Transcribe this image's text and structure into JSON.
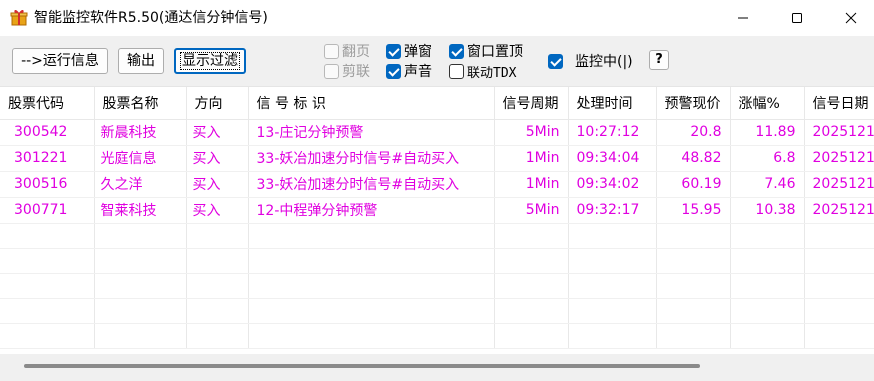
{
  "window": {
    "title": "智能监控软件R5.50(通达信分钟信号)"
  },
  "toolbar": {
    "run_info_label": "-->运行信息",
    "export_label": "输出",
    "filter_label": "显示过滤",
    "checkboxes": {
      "fanye": {
        "label": "翻页",
        "checked": false,
        "disabled": true
      },
      "jianlian": {
        "label": "剪联",
        "checked": false,
        "disabled": true
      },
      "tanchuang": {
        "label": "弹窗",
        "checked": true
      },
      "shengyin": {
        "label": "声音",
        "checked": true
      },
      "zhiding": {
        "label": "窗口置顶",
        "checked": true
      },
      "liandong": {
        "label": "联动TDX",
        "checked": false
      }
    },
    "monitoring_label": "监控中(|)",
    "monitoring_checked": true,
    "help_label": "?"
  },
  "grid": {
    "columns": [
      "股票代码",
      "股票名称",
      "方向",
      "信 号 标 识",
      "信号周期",
      "处理时间",
      "预警现价",
      "涨幅%",
      "信号日期"
    ],
    "rows": [
      [
        "300542",
        "新晨科技",
        "买入",
        "13-庄记分钟预警",
        "5Min",
        "10:27:12",
        "20.8",
        "11.89",
        "2025121"
      ],
      [
        "301221",
        "光庭信息",
        "买入",
        "33-妖冶加速分时信号#自动买入",
        "1Min",
        "09:34:04",
        "48.82",
        "6.8",
        "2025121"
      ],
      [
        "300516",
        "久之洋",
        "买入",
        "33-妖冶加速分时信号#自动买入",
        "1Min",
        "09:34:02",
        "60.19",
        "7.46",
        "2025121"
      ],
      [
        "300771",
        "智莱科技",
        "买入",
        "12-中程弹分钟预警",
        "5Min",
        "09:32:17",
        "15.95",
        "10.38",
        "2025121"
      ]
    ],
    "row_text_color": "#e000e0"
  },
  "colors": {
    "accent": "#0067c0"
  }
}
